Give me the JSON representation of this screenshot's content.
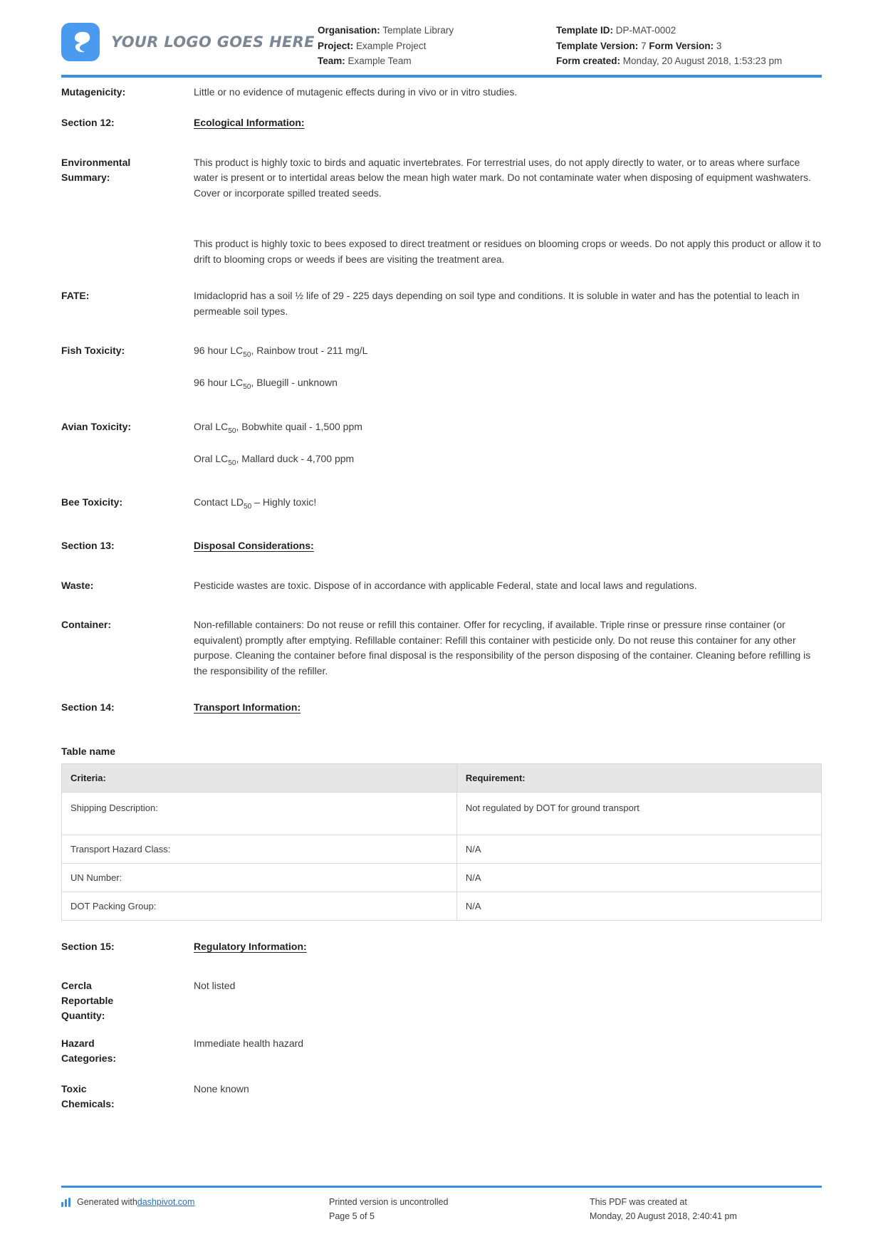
{
  "header": {
    "logo_text": "YOUR LOGO GOES HERE",
    "organisation_label": "Organisation:",
    "organisation_value": "Template Library",
    "project_label": "Project:",
    "project_value": "Example Project",
    "team_label": "Team:",
    "team_value": "Example Team",
    "template_id_label": "Template ID:",
    "template_id_value": "DP-MAT-0002",
    "template_version_label": "Template Version:",
    "template_version_value": "7",
    "form_version_label": "Form Version:",
    "form_version_value": "3",
    "form_created_label": "Form created:",
    "form_created_value": "Monday, 20 August 2018, 1:53:23 pm"
  },
  "accent_color": "#3b8fe0",
  "rows": {
    "mutagenicity_label": "Mutagenicity:",
    "mutagenicity_value": "Little or no evidence of mutagenic effects during in vivo or in vitro studies.",
    "section12_label": "Section 12:",
    "section12_heading": "Ecological Information:",
    "environmental_label": "Environmental Summary:",
    "environmental_p1": "This product is highly toxic to birds and aquatic invertebrates. For terrestrial uses, do not apply directly to water, or to areas where surface water is present or to intertidal areas below the mean high water mark. Do not contaminate water when disposing of equipment washwaters. Cover or incorporate spilled treated seeds.",
    "environmental_p2": "This product is highly toxic to bees exposed to direct treatment or residues on blooming crops or weeds. Do not apply this product or allow it to drift to blooming crops or weeds if bees are visiting the treatment area.",
    "fate_label": "FATE:",
    "fate_value": "Imidacloprid has a soil ½ life of 29 - 225 days depending on soil type and conditions. It is soluble in water and has the potential to leach in permeable soil types.",
    "fish_label": "Fish Toxicity:",
    "fish_line1_pre": "96 hour LC",
    "fish_line1_sub": "50",
    "fish_line1_post": ", Rainbow trout - 211 mg/L",
    "fish_line2_pre": "96 hour LC",
    "fish_line2_sub": "50",
    "fish_line2_post": ", Bluegill - unknown",
    "avian_label": "Avian Toxicity:",
    "avian_line1_pre": "Oral LC",
    "avian_line1_sub": "50",
    "avian_line1_post": ", Bobwhite quail - 1,500 ppm",
    "avian_line2_pre": "Oral LC",
    "avian_line2_sub": "50",
    "avian_line2_post": ", Mallard duck - 4,700 ppm",
    "bee_label": "Bee Toxicity:",
    "bee_line_pre": "Contact LD",
    "bee_line_sub": "50",
    "bee_line_post": " – Highly toxic!",
    "section13_label": "Section 13:",
    "section13_heading": "Disposal Considerations:",
    "waste_label": "Waste:",
    "waste_value": "Pesticide wastes are toxic. Dispose of in accordance with applicable Federal, state and local laws and regulations.",
    "container_label": "Container:",
    "container_value": "Non-refillable containers: Do not reuse or refill this container. Offer for recycling, if available. Triple rinse or pressure rinse container (or equivalent) promptly after emptying. Refillable container: Refill this container with pesticide only. Do not reuse this container for any other purpose. Cleaning the container before final disposal is the responsibility of the person disposing of the container. Cleaning before refilling is the responsibility of the refiller.",
    "section14_label": "Section 14:",
    "section14_heading": "Transport Information:",
    "section15_label": "Section 15:",
    "section15_heading": "Regulatory Information:",
    "cercla_label": "Cercla Reportable Quantity:",
    "cercla_value": "Not listed",
    "hazard_label": "Hazard Categories:",
    "hazard_value": "Immediate health hazard",
    "toxic_label": "Toxic Chemicals:",
    "toxic_value": "None known"
  },
  "table": {
    "name": "Table name",
    "headers": [
      "Criteria:",
      "Requirement:"
    ],
    "rows": [
      [
        "Shipping Description:",
        "Not regulated by DOT for ground transport"
      ],
      [
        "Transport Hazard Class:",
        "N/A"
      ],
      [
        "UN Number:",
        "N/A"
      ],
      [
        "DOT Packing Group:",
        "N/A"
      ]
    ]
  },
  "footer": {
    "generated_prefix": "Generated with ",
    "generated_link": "dashpivot.com",
    "printed_line1": "Printed version is uncontrolled",
    "printed_line2": "Page 5 of 5",
    "created_line1": "This PDF was created at",
    "created_line2": "Monday, 20 August 2018, 2:40:41 pm"
  }
}
